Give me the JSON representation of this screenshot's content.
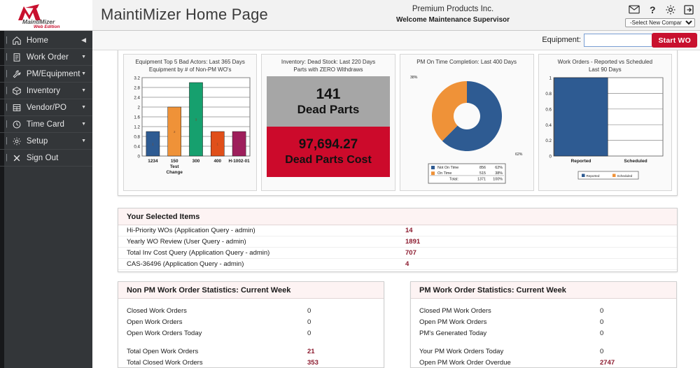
{
  "brand": {
    "name": "MaintiMizer",
    "sub": "Web Edition"
  },
  "header": {
    "title": "MaintiMizer Home Page",
    "company": "Premium Products Inc.",
    "welcome": "Welcome Maintenance Supervisor",
    "company_select_value": "-Select New Company-",
    "icons": [
      "mail-icon",
      "help-icon",
      "gear-icon",
      "logout-icon"
    ]
  },
  "subbar": {
    "equipment_label": "Equipment:",
    "equipment_value": "",
    "equipment_placeholder": "",
    "start_wo_label": "Start WO"
  },
  "sidebar": {
    "items": [
      {
        "label": "Home",
        "icon": "home-icon",
        "caret": "◀"
      },
      {
        "label": "Work Order",
        "icon": "document-icon",
        "caret": "▼"
      },
      {
        "label": "PM/Equipment",
        "icon": "wrench-icon",
        "caret": "▼"
      },
      {
        "label": "Inventory",
        "icon": "box-icon",
        "caret": "▼"
      },
      {
        "label": "Vendor/PO",
        "icon": "table-icon",
        "caret": "▼"
      },
      {
        "label": "Time Card",
        "icon": "clock-icon",
        "caret": "▼"
      },
      {
        "label": "Setup",
        "icon": "gear-icon",
        "caret": "▼"
      },
      {
        "label": "Sign Out",
        "icon": "close-icon",
        "caret": ""
      }
    ]
  },
  "chart_data": [
    {
      "type": "bar",
      "title": "Equipment Top 5 Bad Actors: Last 365 Days",
      "subtitle": "Equipment by # of Non-PM WO's",
      "categories": [
        "1234",
        "150 Test Change",
        "300",
        "400",
        "H-1002-01"
      ],
      "category_lines": [
        [
          "1234"
        ],
        [
          "150",
          "Test",
          "Change"
        ],
        [
          "300"
        ],
        [
          "400"
        ],
        [
          "H-1002-01"
        ]
      ],
      "values": [
        1,
        2,
        3,
        1,
        1
      ],
      "colors": [
        "#2e5b92",
        "#ef9238",
        "#16a06e",
        "#e04f1a",
        "#9e1f5c"
      ],
      "ylim": [
        0,
        3.2
      ],
      "yticks": [
        0,
        0.4,
        0.8,
        1.2,
        1.6,
        2,
        2.4,
        2.8,
        3.2
      ],
      "ytick_labels": [
        "0",
        "0.4",
        "0.8",
        "1.2",
        "1.6",
        "2",
        "2.4",
        "2.8",
        "3.2"
      ],
      "xlabel": "",
      "ylabel": "",
      "grid": true,
      "legend": false
    },
    {
      "type": "table",
      "title": "Inventory: Dead Stock: Last 220 Days",
      "subtitle": "Parts with ZERO Withdraws",
      "cells": [
        {
          "value": "141",
          "label": "Dead Parts",
          "bg": "#a6a6a6"
        },
        {
          "value": "97,694.27",
          "label": "Dead Parts Cost",
          "bg": "#cc0a2b"
        }
      ]
    },
    {
      "type": "pie",
      "title": "PM On Time Completion: Last 400 Days",
      "subtitle": "",
      "labels": [
        "Not On Time",
        "On Time"
      ],
      "values": [
        856,
        515
      ],
      "percents": [
        "62%",
        "38%"
      ],
      "colors": [
        "#2e5b92",
        "#ef9238"
      ],
      "outside_labels": [
        "38%",
        "62%"
      ],
      "legend": [
        {
          "name": "Not On Time",
          "count": "856",
          "pct": "62%",
          "color": "#2e5b92"
        },
        {
          "name": "On Time",
          "count": "515",
          "pct": "38%",
          "color": "#ef9238"
        }
      ],
      "total_label": "Total:",
      "total_count": "1371",
      "total_pct": "100%",
      "legend_position": "bottom"
    },
    {
      "type": "bar",
      "title": "Work Orders - Reported vs Scheduled",
      "subtitle": "Last 90 Days",
      "categories": [
        "Reported",
        "Scheduled"
      ],
      "values": [
        1,
        0
      ],
      "colors": [
        "#2e5b92",
        "#ef9238"
      ],
      "ylim": [
        0,
        1
      ],
      "yticks": [
        0,
        0.2,
        0.4,
        0.6,
        0.8,
        1
      ],
      "ytick_labels": [
        "0",
        "0.2",
        "0.4",
        "0.6",
        "0.8",
        "1"
      ],
      "legend": [
        {
          "name": "Reported",
          "color": "#2e5b92"
        },
        {
          "name": "Scheduled",
          "color": "#ef9238"
        }
      ],
      "legend_position": "bottom",
      "grid": true
    }
  ],
  "selected_items": {
    "title": "Your Selected Items",
    "rows": [
      {
        "label": "Hi-Priority WOs (Application Query - admin)",
        "value": "14"
      },
      {
        "label": "Yearly WO Review (User Query - admin)",
        "value": "1891"
      },
      {
        "label": "Total Inv Cost Query (Application Query - admin)",
        "value": "707"
      },
      {
        "label": "CAS-36496 (Application Query - admin)",
        "value": "4"
      }
    ]
  },
  "non_pm_stats": {
    "title": "Non PM Work Order Statistics: Current Week",
    "rows": [
      {
        "label": "Closed Work Orders",
        "value": "0",
        "accent": false
      },
      {
        "label": "Open Work Orders",
        "value": "0",
        "accent": false
      },
      {
        "label": "Open Work Orders Today",
        "value": "0",
        "accent": false
      },
      {
        "label": "Total Open Work Orders",
        "value": "21",
        "accent": true
      },
      {
        "label": "Total Closed Work Orders",
        "value": "353",
        "accent": true
      }
    ]
  },
  "pm_stats": {
    "title": "PM Work Order Statistics: Current Week",
    "rows": [
      {
        "label": "Closed PM Work Orders",
        "value": "0",
        "accent": false
      },
      {
        "label": "Open PM Work Orders",
        "value": "0",
        "accent": false
      },
      {
        "label": "PM's Generated Today",
        "value": "0",
        "accent": false
      },
      {
        "label": "Your PM Work Orders Today",
        "value": "0",
        "accent": false
      },
      {
        "label": "Open PM Work Order Overdue",
        "value": "2747",
        "accent": true
      }
    ]
  },
  "colors": {
    "accent_red": "#c8102e",
    "sidebar_bg": "#333639",
    "value_red": "#8c1b2f",
    "chart_blue": "#2e5b92",
    "chart_orange": "#ef9238"
  }
}
